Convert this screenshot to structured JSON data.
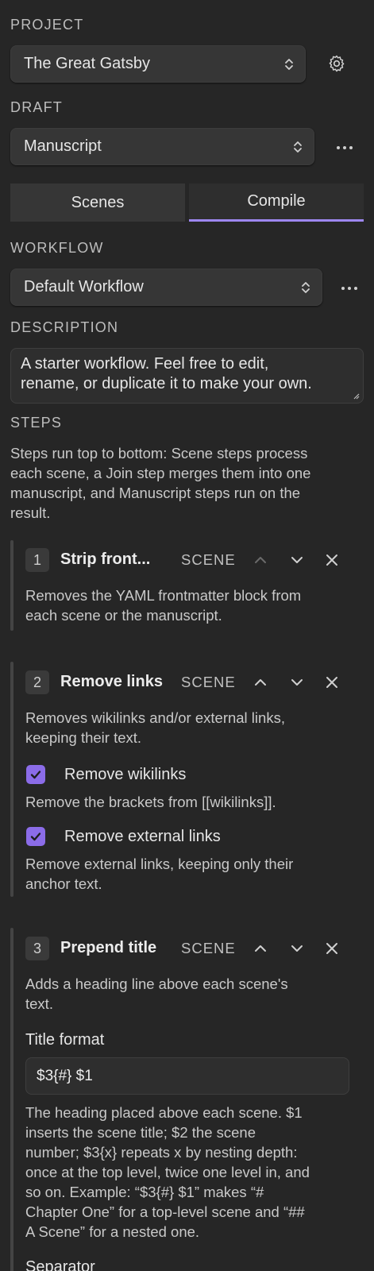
{
  "project": {
    "label": "PROJECT",
    "selected": "The Great Gatsby",
    "settings_icon": "gear-icon"
  },
  "draft": {
    "label": "DRAFT",
    "selected": "Manuscript",
    "more_icon": "ellipsis-icon"
  },
  "tabs": [
    {
      "label": "Scenes",
      "active": false
    },
    {
      "label": "Compile",
      "active": true
    }
  ],
  "workflow": {
    "label": "WORKFLOW",
    "selected": "Default Workflow",
    "more_icon": "ellipsis-icon"
  },
  "description": {
    "label": "DESCRIPTION",
    "value_line1": "A starter workflow. Feel free to edit,",
    "value_line2": "rename, or duplicate it to make your own."
  },
  "steps": {
    "label": "STEPS",
    "intro_lines": [
      "Steps run top to bottom: Scene steps process",
      "each scene, a Join step merges them into one",
      "manuscript, and Manuscript steps run on the",
      "result."
    ],
    "items": [
      {
        "number": "1",
        "title": "Strip front...",
        "kind": "SCENE",
        "desc_lines": [
          "Removes the YAML frontmatter block from",
          "each scene or the manuscript."
        ]
      },
      {
        "number": "2",
        "title": "Remove links",
        "kind": "SCENE",
        "desc_lines": [
          "Removes wikilinks and/or external links,",
          "keeping their text."
        ],
        "options": [
          {
            "label": "Remove wikilinks",
            "checked": true,
            "help_lines": [
              "Remove the brackets from [[wikilinks]]."
            ]
          },
          {
            "label": "Remove external links",
            "checked": true,
            "help_lines": [
              "Remove external links, keeping only their",
              "anchor text."
            ]
          }
        ]
      },
      {
        "number": "3",
        "title": "Prepend title",
        "kind": "SCENE",
        "desc_lines": [
          "Adds a heading line above each scene's",
          "text."
        ],
        "field_label": "Title format",
        "field_value": "$3{#} $1",
        "help_lines": [
          "The heading placed above each scene. $1",
          "inserts the scene title; $2 the scene",
          "number; $3{x} repeats x by nesting depth:",
          "once at the top level, twice one level in, and",
          "so on. Example: “$3{#} $1” makes “#",
          "Chapter One” for a top-level scene and “##",
          "A Scene” for a nested one."
        ],
        "next_label": "Separator"
      }
    ]
  },
  "colors": {
    "background": "#262626",
    "accent": "#8b6ce8",
    "tab_underline": "#9d87f0"
  }
}
